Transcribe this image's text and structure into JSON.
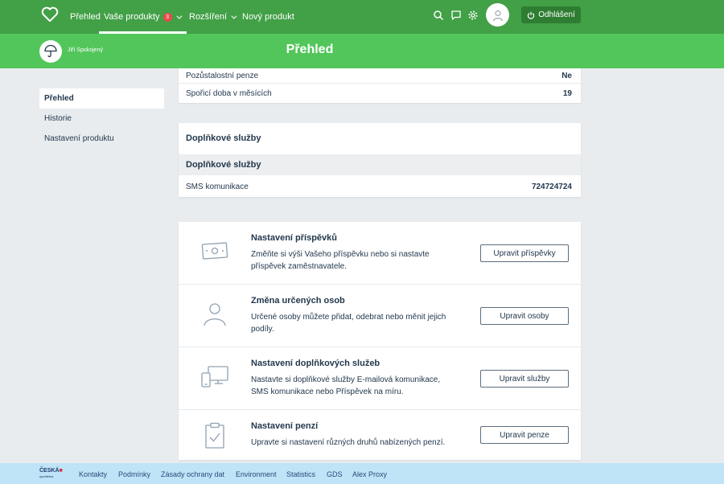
{
  "nav": {
    "overview": "Přehled",
    "products": "Vaše produkty",
    "products_badge": "3",
    "extensions": "Rozšíření",
    "new_product": "Nový produkt",
    "logout": "Odhlášení"
  },
  "header": {
    "user_name": "Jiří Spokojený",
    "title": "Přehled"
  },
  "sidebar": {
    "items": [
      {
        "label": "Přehled"
      },
      {
        "label": "Historie"
      },
      {
        "label": "Nastavení produktu"
      }
    ]
  },
  "info_card": {
    "rows": [
      {
        "label": "Pozůstalostní penze",
        "value": "Ne"
      },
      {
        "label": "Spořicí doba v měsících",
        "value": "19"
      }
    ]
  },
  "services_card": {
    "title": "Doplňkové služby",
    "subhead": "Doplňkové služby",
    "rows": [
      {
        "label": "SMS komunikace",
        "value": "724724724"
      }
    ]
  },
  "actions": [
    {
      "title": "Nastavení příspěvků",
      "desc": "Změňte si výši Vašeho příspěvku nebo si nastavte příspěvek zaměstnavatele.",
      "button": "Upravit příspěvky"
    },
    {
      "title": "Změna určených osob",
      "desc": "Určené osoby můžete přidat, odebrat nebo měnit jejich podíly.",
      "button": "Upravit osoby"
    },
    {
      "title": "Nastavení doplňkových služeb",
      "desc": "Nastavte si doplňkové služby E-mailová komunikace, SMS komunikace nebo Příspěvek na míru.",
      "button": "Upravit služby"
    },
    {
      "title": "Nastavení penzí",
      "desc": "Upravte si nastavení různých druhů nabízených penzí.",
      "button": "Upravit penze"
    }
  ],
  "footer": {
    "logo_line1": "ČESKÁ",
    "logo_line2": "spořitelna",
    "links": [
      "Kontakty",
      "Podmínky",
      "Zásady ochrany dat",
      "Environment",
      "Statistics",
      "GDS",
      "Alex Proxy"
    ]
  },
  "colors": {
    "nav": "#42a047",
    "header": "#52c65a",
    "background": "#e8ecef",
    "footer": "#bfe3f7"
  }
}
